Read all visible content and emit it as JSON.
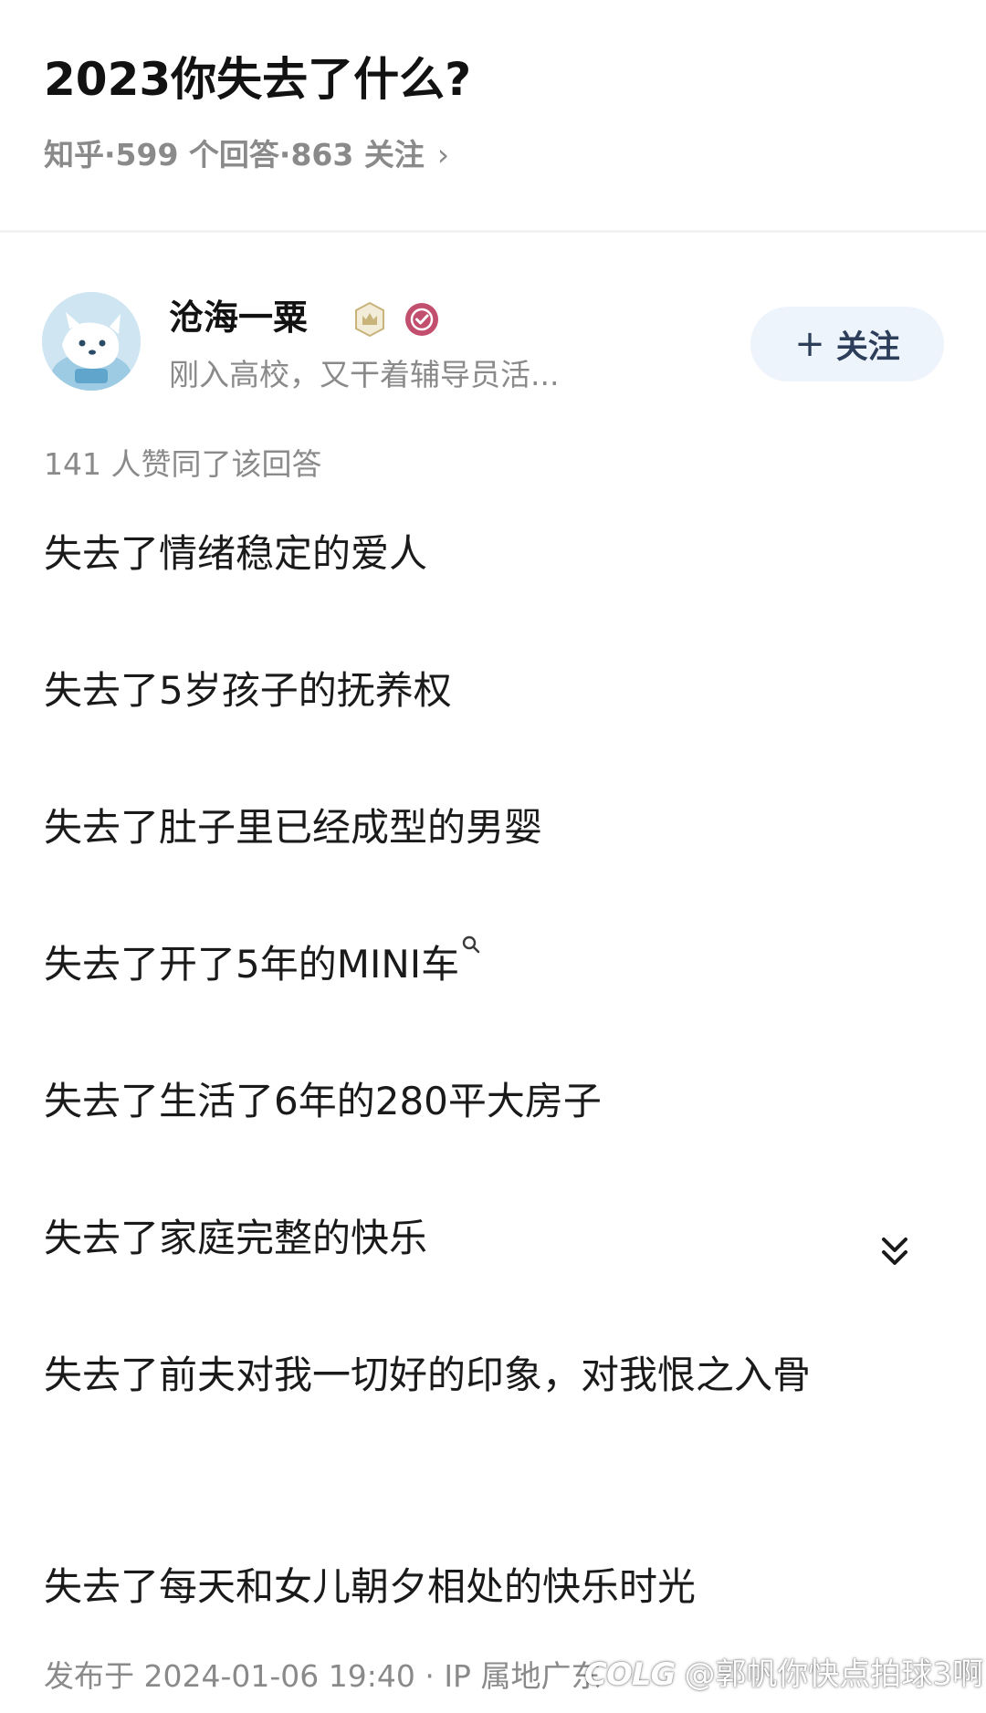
{
  "question": {
    "title": "2023你失去了什么?",
    "source": "知乎",
    "answers_count": "599 个回答",
    "followers_count": "863 关注",
    "separator": "·",
    "chevron": "›"
  },
  "author": {
    "name": "沧海一粟",
    "bio": "刚入高校，又干着辅导员活...",
    "follow_label": "关注",
    "follow_plus": "+"
  },
  "answer": {
    "upvote_text": "141 人赞同了该回答",
    "lines": [
      "失去了情绪稳定的爱人",
      "失去了5岁孩子的抚养权",
      "失去了肚子里已经成型的男婴",
      "失去了开了5年的MINI车",
      "失去了生活了6年的280平大房子",
      "失去了家庭完整的快乐",
      "失去了前夫对我一切好的印象，对我恨之入骨",
      "失去了每天和女儿朝夕相处的快乐时光"
    ],
    "published": "发布于 2024-01-06 19:40 · IP 属地",
    "published_tail": "广东"
  },
  "watermark": {
    "logo": "COLG",
    "handle": "@郭帆你快点拍球3啊"
  },
  "icons": {
    "expand": "double-chevron-down-icon",
    "search": "search-icon",
    "badge_level": "crown-badge-icon",
    "badge_verified": "verified-badge-icon"
  },
  "colors": {
    "title": "#121212",
    "meta": "#8a8a8a",
    "follow_bg": "#eef4fb",
    "follow_text": "#2c3e5a",
    "verified_badge": "#c24f6e",
    "level_badge": "#c8b37a"
  }
}
